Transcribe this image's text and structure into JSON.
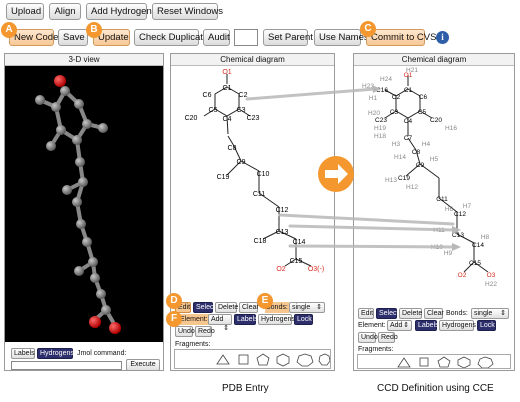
{
  "toolbar": {
    "upload": "Upload",
    "align": "Align",
    "add_hydrogens": "Add Hydrogens",
    "reset_windows": "Reset Windows",
    "new_code": "New Code",
    "save": "Save",
    "update": "Update",
    "check_duplicate": "Check Duplicate",
    "audit": "Audit",
    "audit_value": "",
    "set_parent": "Set Parent",
    "use_names": "Use Names",
    "commit": "Commit to CVS",
    "info": "i"
  },
  "callouts": {
    "a": "A",
    "b": "B",
    "c": "C",
    "d": "D",
    "e": "E",
    "f": "F"
  },
  "viewer3d": {
    "title": "3-D view",
    "labels": "Labels",
    "hydrogens": "Hydrogens",
    "jmol_label": "Jmol command:",
    "jmol_value": "",
    "execute": "Execute"
  },
  "pdb_panel": {
    "title": "Chemical diagram",
    "edit": "Edit",
    "select": "Select",
    "delete": "Delete",
    "clear": "Clear",
    "bonds_label": "Bonds:",
    "bonds_value": "single",
    "element_label": "Element:",
    "element_value": "Add",
    "labels": "Labels",
    "hydrogens": "Hydrogens",
    "lock": "Lock",
    "undo": "Undo",
    "redo": "Redo",
    "fragments": "Fragments:",
    "caption": "PDB Entry"
  },
  "ccd_panel": {
    "title": "Chemical diagram",
    "edit": "Edit",
    "select": "Select",
    "delete": "Delete",
    "clear": "Clear",
    "bonds_label": "Bonds:",
    "bonds_value": "single",
    "element_label": "Element:",
    "element_value": "Add",
    "labels": "Labels",
    "hydrogens": "Hydrogens",
    "lock": "Lock",
    "undo": "Undo",
    "redo": "Redo",
    "fragments": "Fragments:",
    "caption": "CCD Definition using CCE"
  },
  "pdb_atoms": [
    "O1",
    "C1",
    "C2",
    "C6",
    "C5",
    "C20",
    "C4",
    "C3",
    "C23",
    "C8",
    "C9",
    "C19",
    "C10",
    "C11",
    "C12",
    "C13",
    "C18",
    "C14",
    "C15",
    "O2",
    "O3(-)"
  ],
  "ccd_atoms": [
    "H21",
    "O1",
    "H23",
    "H24",
    "C16",
    "C1",
    "C2",
    "H1",
    "H20",
    "C3",
    "C6",
    "C5",
    "C20",
    "C23",
    "C4",
    "H18",
    "H19",
    "H16",
    "C7",
    "H3",
    "C8",
    "H4",
    "H14",
    "C9",
    "H5",
    "H13",
    "C19",
    "H12",
    "C11",
    "H6",
    "H7",
    "C12",
    "H11",
    "C13",
    "H8",
    "H10",
    "H9",
    "C14",
    "C15",
    "O2",
    "O3",
    "H22"
  ],
  "colors": {
    "accent": "#f3972e",
    "oxygen": "#d62a1e",
    "select": "#2c2f6b"
  }
}
